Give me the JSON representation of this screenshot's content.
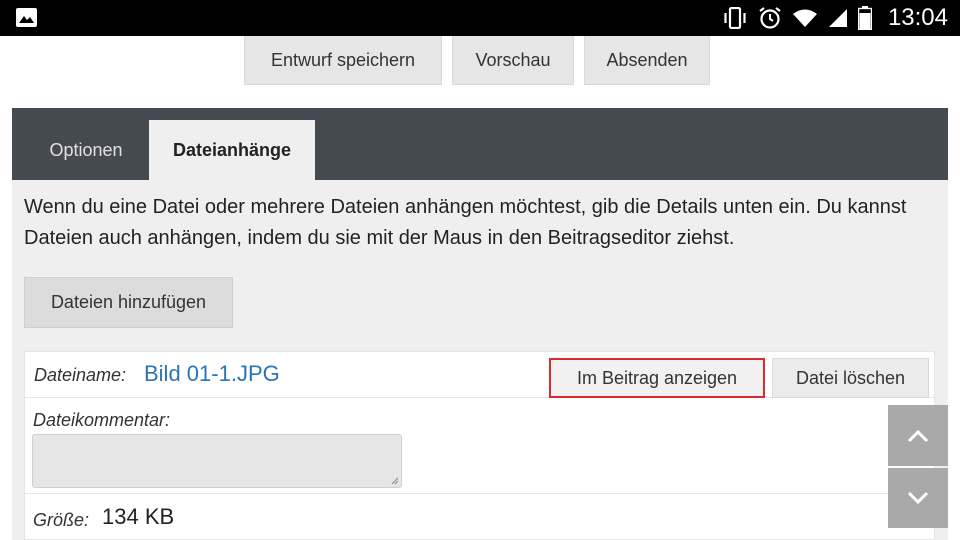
{
  "status_bar": {
    "time": "13:04",
    "icons": [
      "image-icon",
      "vibrate-icon",
      "alarm-icon",
      "wifi-icon",
      "signal-icon",
      "battery-icon"
    ]
  },
  "toolbar": {
    "save_draft_label": "Entwurf speichern",
    "preview_label": "Vorschau",
    "submit_label": "Absenden"
  },
  "tabs": [
    {
      "label": "Optionen",
      "active": false
    },
    {
      "label": "Dateianhänge",
      "active": true
    }
  ],
  "attachments": {
    "info_text": "Wenn du eine Datei oder mehrere Dateien anhängen möchtest, gib die Details unten ein. Du kannst Dateien auch anhängen, indem du sie mit der Maus in den Beitragseditor ziehst.",
    "add_files_label": "Dateien hinzufügen",
    "file": {
      "filename_label": "Dateiname:",
      "filename": "Bild 01-1.JPG",
      "show_in_post_label": "Im Beitrag anzeigen",
      "delete_label": "Datei löschen",
      "comment_label": "Dateikommentar:",
      "comment_value": "",
      "size_label": "Größe:",
      "size_value": "134 KB"
    }
  },
  "colors": {
    "tabbar": "#454a50",
    "panel": "#efefef",
    "link": "#2a73b7",
    "highlight": "#d92c2c"
  }
}
